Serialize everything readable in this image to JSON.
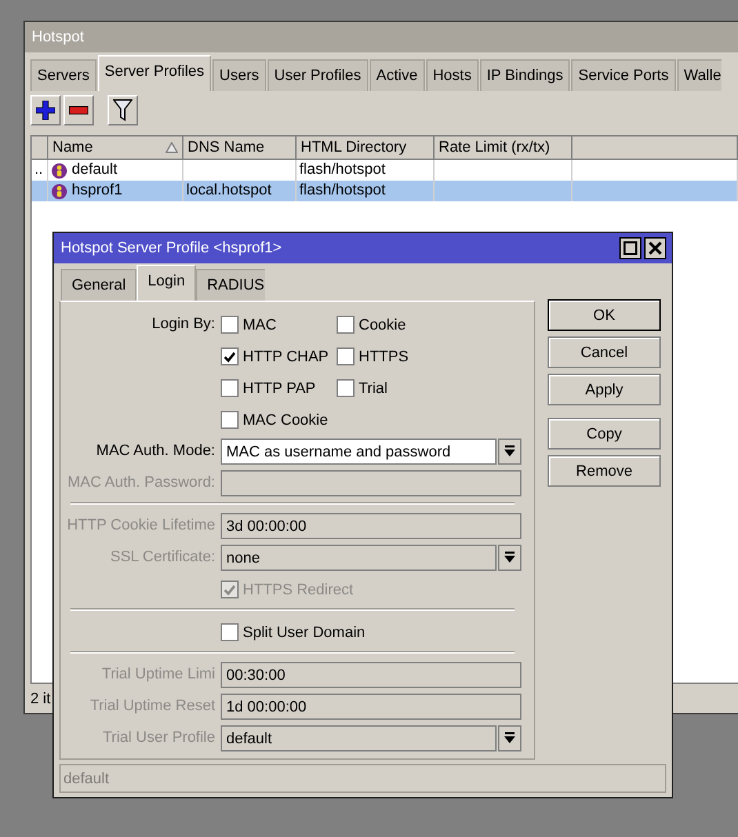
{
  "window": {
    "title": "Hotspot"
  },
  "tabs": [
    {
      "label": "Servers",
      "selected": false
    },
    {
      "label": "Server Profiles",
      "selected": true
    },
    {
      "label": "Users",
      "selected": false
    },
    {
      "label": "User Profiles",
      "selected": false
    },
    {
      "label": "Active",
      "selected": false
    },
    {
      "label": "Hosts",
      "selected": false
    },
    {
      "label": "IP Bindings",
      "selected": false
    },
    {
      "label": "Service Ports",
      "selected": false
    },
    {
      "label": "Walle",
      "selected": false
    }
  ],
  "toolbar": [
    {
      "kind": "add"
    },
    {
      "kind": "remove"
    },
    {
      "kind": "filter"
    }
  ],
  "table": {
    "columns": [
      {
        "label": "Name",
        "sorted": true
      },
      {
        "label": "DNS Name",
        "sorted": false
      },
      {
        "label": "HTML Directory",
        "sorted": false
      },
      {
        "label": "Rate Limit (rx/tx)",
        "sorted": false
      }
    ],
    "rows": [
      {
        "flag": "..",
        "name": "default",
        "html_directory": "flash/hotspot",
        "selected": false
      },
      {
        "name": "hsprof1",
        "dns_name": "local.hotspot",
        "html_directory": "flash/hotspot",
        "selected": true
      }
    ]
  },
  "status_bar": {
    "text": "2 it"
  },
  "dialog": {
    "title": "Hotspot Server Profile <hsprof1>",
    "tabs": [
      {
        "label": "General",
        "selected": false
      },
      {
        "label": "Login",
        "selected": true
      },
      {
        "label": "RADIUS",
        "selected": false
      }
    ],
    "sections": [
      [
        {
          "kind": "checkgroup",
          "label": "Login By:",
          "options": [
            {
              "label": "MAC",
              "checked": false
            },
            {
              "label": "Cookie",
              "checked": false
            },
            {
              "label": "HTTP CHAP",
              "checked": true
            },
            {
              "label": "HTTPS",
              "checked": false
            },
            {
              "label": "HTTP PAP",
              "checked": false
            },
            {
              "label": "Trial",
              "checked": false
            },
            {
              "label": "MAC Cookie",
              "checked": false
            }
          ]
        },
        {
          "kind": "dropdown",
          "label": "MAC Auth. Mode:",
          "value": "MAC as username and password",
          "disabled": false
        },
        {
          "kind": "text",
          "label": "MAC Auth. Password:",
          "disabled": true
        }
      ],
      [
        {
          "kind": "text",
          "label": "HTTP Cookie Lifetime",
          "value": "3d 00:00:00",
          "disabled": true
        },
        {
          "kind": "dropdown",
          "label": "SSL Certificate:",
          "value": "none",
          "disabled": true
        },
        {
          "kind": "checkbox",
          "label": "HTTPS Redirect",
          "checked": true,
          "disabled": true
        }
      ],
      [
        {
          "kind": "checkbox",
          "label": "Split User Domain",
          "checked": false,
          "disabled": false
        }
      ],
      [
        {
          "kind": "text",
          "label": "Trial Uptime Limi",
          "value": "00:30:00",
          "disabled": true
        },
        {
          "kind": "text",
          "label": "Trial Uptime Reset",
          "value": "1d 00:00:00",
          "disabled": true
        },
        {
          "kind": "dropdown",
          "label": "Trial User Profile",
          "value": "default",
          "disabled": true
        }
      ]
    ],
    "button_groups": [
      [
        {
          "label": "OK",
          "primary": true
        },
        {
          "label": "Cancel",
          "primary": false
        },
        {
          "label": "Apply",
          "primary": false
        }
      ],
      [
        {
          "label": "Copy",
          "primary": false
        },
        {
          "label": "Remove",
          "primary": false
        }
      ]
    ],
    "status_text": "default"
  }
}
